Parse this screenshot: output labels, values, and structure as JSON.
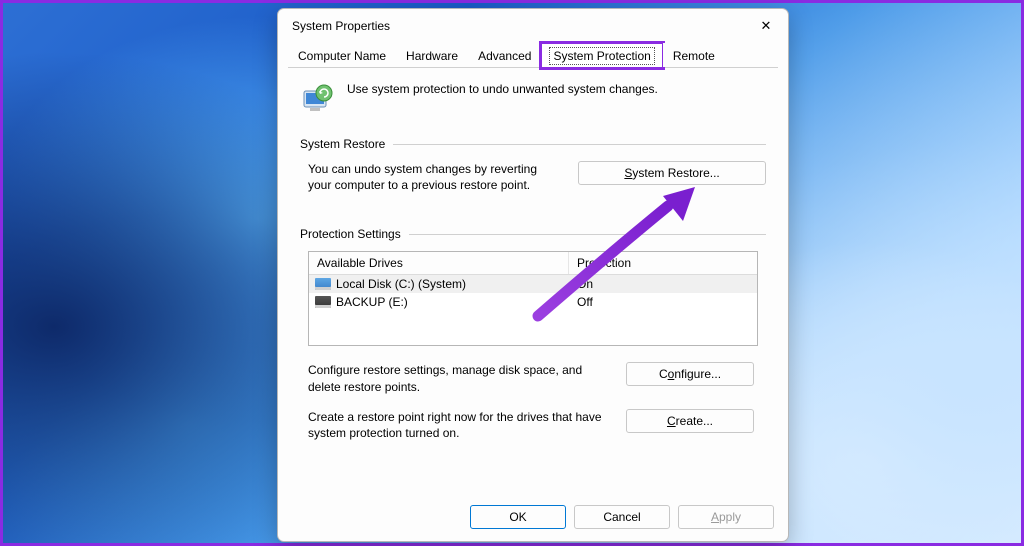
{
  "window": {
    "title": "System Properties",
    "close": "✕"
  },
  "tabs": {
    "items": [
      {
        "label": "Computer Name"
      },
      {
        "label": "Hardware"
      },
      {
        "label": "Advanced"
      },
      {
        "label": "System Protection"
      },
      {
        "label": "Remote"
      }
    ]
  },
  "intro": {
    "text": "Use system protection to undo unwanted system changes."
  },
  "restore_section": {
    "heading": "System Restore",
    "desc": "You can undo system changes by reverting your computer to a previous restore point.",
    "button_prefix": "S",
    "button_rest": "ystem Restore..."
  },
  "protection_section": {
    "heading": "Protection Settings",
    "col_drive": "Available Drives",
    "col_prot": "Protection",
    "rows": [
      {
        "name": "Local Disk (C:) (System)",
        "status": "On",
        "sys": true
      },
      {
        "name": "BACKUP (E:)",
        "status": "Off",
        "sys": false
      }
    ],
    "configure_desc": "Configure restore settings, manage disk space, and delete restore points.",
    "configure_prefix": "C",
    "configure_u": "o",
    "configure_rest": "nfigure...",
    "create_desc": "Create a restore point right now for the drives that have system protection turned on.",
    "create_u": "C",
    "create_rest": "reate..."
  },
  "footer": {
    "ok": "OK",
    "cancel": "Cancel",
    "apply_u": "A",
    "apply_rest": "pply"
  }
}
